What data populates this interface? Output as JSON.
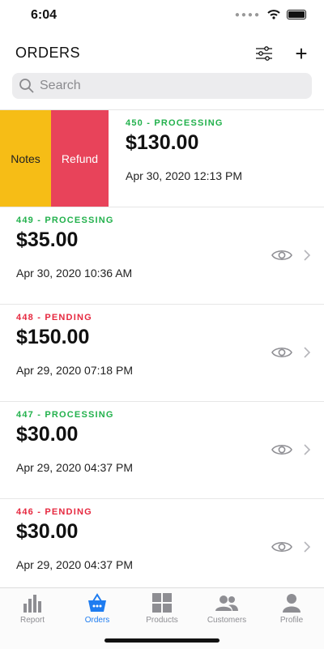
{
  "status_bar": {
    "time": "6:04"
  },
  "header": {
    "title": "ORDERS"
  },
  "search": {
    "placeholder": "Search"
  },
  "swipe_actions": {
    "notes": "Notes",
    "refund": "Refund"
  },
  "colors": {
    "processing": "#22b14c",
    "pending": "#e6283f",
    "notes_bg": "#f6bd16",
    "refund_bg": "#e8435a",
    "accent": "#1e7cf0"
  },
  "orders": [
    {
      "status": "450 - PROCESSING",
      "amount": "$130.00",
      "date": "Apr 30, 2020 12:13 PM"
    },
    {
      "status": "449 - PROCESSING",
      "amount": "$35.00",
      "date": "Apr 30, 2020 10:36 AM"
    },
    {
      "status": "448 - PENDING",
      "amount": "$150.00",
      "date": "Apr 29, 2020 07:18 PM"
    },
    {
      "status": "447 - PROCESSING",
      "amount": "$30.00",
      "date": "Apr 29, 2020 04:37 PM"
    },
    {
      "status": "446 - PENDING",
      "amount": "$30.00",
      "date": "Apr 29, 2020 04:37 PM"
    }
  ],
  "tabs": [
    {
      "label": "Report",
      "icon": "bar-chart-icon"
    },
    {
      "label": "Orders",
      "icon": "basket-icon"
    },
    {
      "label": "Products",
      "icon": "grid-icon"
    },
    {
      "label": "Customers",
      "icon": "people-icon"
    },
    {
      "label": "Profile",
      "icon": "person-icon"
    }
  ]
}
